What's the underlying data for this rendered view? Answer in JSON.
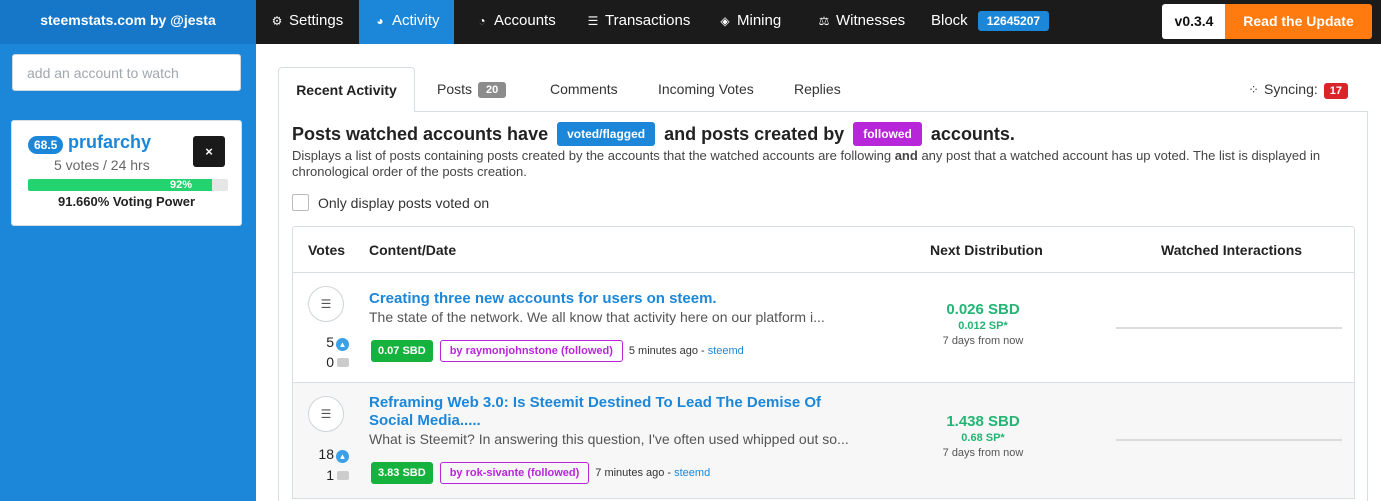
{
  "sidebar": {
    "brand": "steemstats.com by @jesta",
    "watch_placeholder": "add an account to watch",
    "account": {
      "reputation": "68.5",
      "name": "prufarchy",
      "votes_text": "5 votes / 24 hrs",
      "remove_label": "×",
      "vp_percent": 92,
      "vp_bar_label": "92%",
      "vp_text": "91.660% Voting Power"
    }
  },
  "nav": {
    "items": [
      {
        "label": "Settings",
        "icon": "gears-icon"
      },
      {
        "label": "Activity",
        "icon": "rss-icon"
      },
      {
        "label": "Accounts",
        "icon": "pie-chart-icon"
      },
      {
        "label": "Transactions",
        "icon": "list-icon"
      },
      {
        "label": "Mining",
        "icon": "cube-icon"
      },
      {
        "label": "Witnesses",
        "icon": "balance-scale-icon"
      },
      {
        "label": "Block",
        "icon": ""
      }
    ],
    "active": "Activity",
    "block_number": "12645207",
    "version": "v0.3.4",
    "update_label": "Read the Update"
  },
  "tabs": {
    "recent": "Recent Activity",
    "posts": "Posts",
    "posts_count": "20",
    "comments": "Comments",
    "incoming_votes": "Incoming Votes",
    "replies": "Replies",
    "syncing_label": "Syncing:",
    "syncing_count": "17"
  },
  "content": {
    "headline_1": "Posts watched accounts have",
    "label_voted": "voted/flagged",
    "headline_2": "and posts created by",
    "label_followed": "followed",
    "headline_3": "accounts.",
    "desc_1": "Displays a list of posts containing posts created by the accounts that the watched accounts are following",
    "desc_and": "and",
    "desc_2": "any post that a watched account has up voted. The list is displayed in chronological order of the posts creation.",
    "only_voted_label": "Only display posts voted on"
  },
  "table": {
    "headers": {
      "votes": "Votes",
      "content": "Content/Date",
      "next": "Next Distribution",
      "watched": "Watched Interactions"
    },
    "rows": [
      {
        "upvotes": "5",
        "comments": "0",
        "title": "Creating three new accounts for users on steem.",
        "excerpt": "The state of the network. We all know that activity here on our platform i...",
        "payout": "0.07 SBD",
        "author": "by raymonjohnstone (followed)",
        "time": "5 minutes ago -",
        "app": "steemd",
        "next_sbd": "0.026 SBD",
        "next_sp": "0.012 SP*",
        "next_when": "7 days from now"
      },
      {
        "upvotes": "18",
        "comments": "1",
        "title": "Reframing Web 3.0: Is Steemit Destined To Lead The Demise Of Social Media.....",
        "excerpt": "What is Steemit? In answering this question, I've often used whipped out so...",
        "payout": "3.83 SBD",
        "author": "by rok-sivante (followed)",
        "time": "7 minutes ago -",
        "app": "steemd",
        "next_sbd": "1.438 SBD",
        "next_sp": "0.68 SP*",
        "next_when": "7 days from now"
      }
    ]
  }
}
